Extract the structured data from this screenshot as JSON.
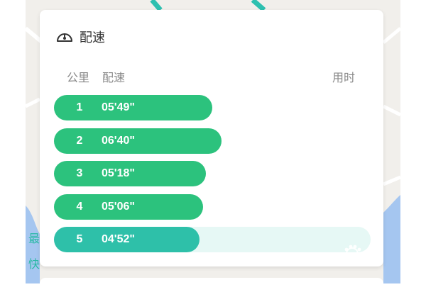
{
  "card": {
    "title": "配速",
    "title_icon": "speedometer-icon"
  },
  "columns": {
    "km": "公里",
    "pace": "配速",
    "time": "用时"
  },
  "splits": [
    {
      "km": "1",
      "pace": "05'49\"",
      "fraction": 0.5,
      "color": "#2cc27d"
    },
    {
      "km": "2",
      "pace": "06'40\"",
      "fraction": 0.53,
      "color": "#2cc27d"
    },
    {
      "km": "3",
      "pace": "05'18\"",
      "fraction": 0.48,
      "color": "#2cc27d"
    },
    {
      "km": "4",
      "pace": "05'06\"",
      "fraction": 0.47,
      "color": "#2cc27d"
    },
    {
      "km": "5",
      "pace": "04'52\"",
      "fraction": 0.46,
      "color": "#2ec0a9",
      "badge": "最快"
    }
  ],
  "colors": {
    "accent": "#2cc27d",
    "fastest": "#2ec0a9",
    "track": "#e6f8f5"
  }
}
